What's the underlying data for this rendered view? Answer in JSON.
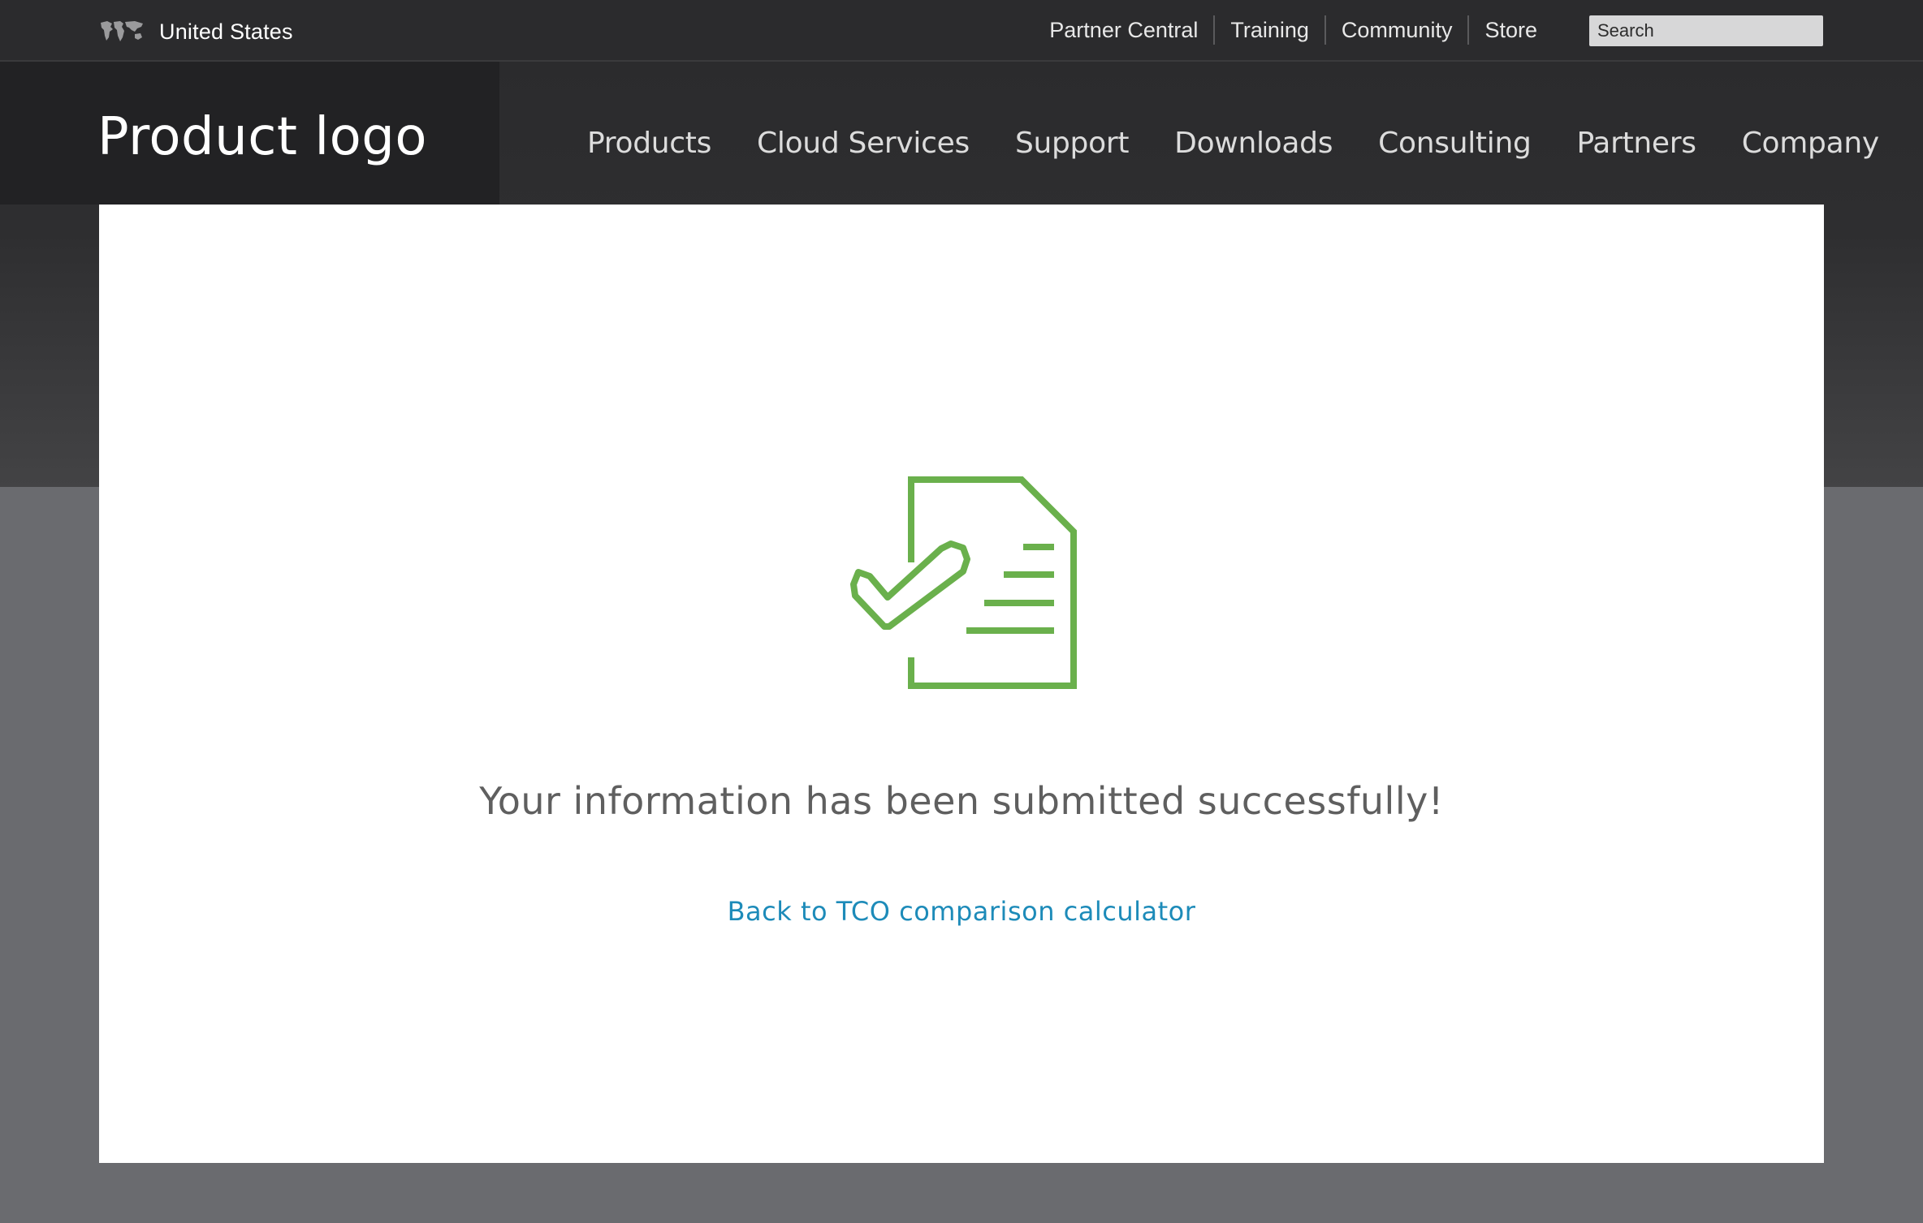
{
  "utility_bar": {
    "region": {
      "icon": "world-map-icon",
      "label": "United States"
    },
    "links": [
      {
        "label": "Partner Central"
      },
      {
        "label": "Training"
      },
      {
        "label": "Community"
      },
      {
        "label": "Store"
      }
    ],
    "search": {
      "placeholder": "Search",
      "value": ""
    }
  },
  "header": {
    "logo_text": "Product logo",
    "nav": [
      {
        "label": "Products"
      },
      {
        "label": "Cloud Services"
      },
      {
        "label": "Support"
      },
      {
        "label": "Downloads"
      },
      {
        "label": "Consulting"
      },
      {
        "label": "Partners"
      },
      {
        "label": "Company"
      }
    ]
  },
  "main": {
    "icon": "document-check-icon",
    "message": "Your information has been submitted successfully!",
    "back_link": "Back to TCO comparison calculator"
  },
  "colors": {
    "success_green": "#6ab04c",
    "link_blue": "#1d8bb9",
    "page_background": "#6a6b6f",
    "header_dark": "#2b2b2d"
  }
}
